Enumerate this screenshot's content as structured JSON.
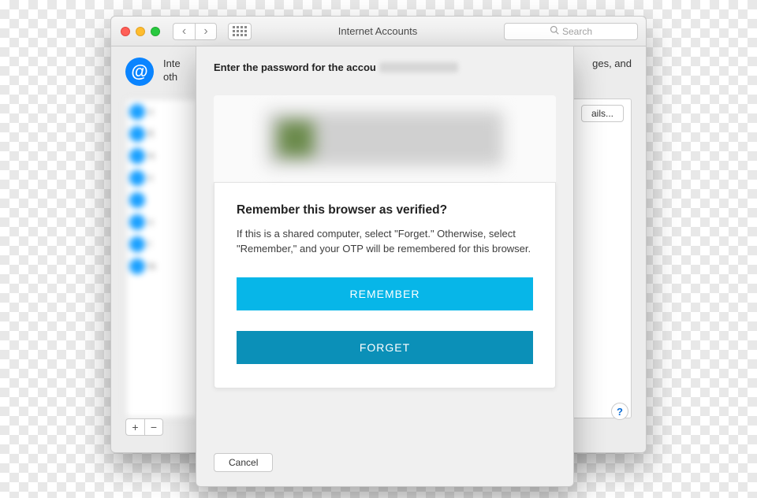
{
  "window": {
    "title": "Internet Accounts",
    "search_placeholder": "Search",
    "intro_line1": "Inte",
    "intro_line2": "oth",
    "intro_right": "ges, and",
    "details_label": "ails...",
    "add_label": "+",
    "remove_label": "−",
    "help_label": "?"
  },
  "sheet": {
    "title_prefix": "Enter the password for the accou",
    "card": {
      "heading": "Remember this browser as verified?",
      "body": "If this is a shared computer, select \"Forget.\" Otherwise, select \"Remember,\" and your OTP will be remembered for this browser.",
      "remember_label": "REMEMBER",
      "forget_label": "FORGET"
    },
    "cancel_label": "Cancel"
  },
  "sidebar": {
    "items": [
      "u",
      "E",
      "is",
      "s",
      "",
      "u",
      "t",
      "ta"
    ]
  }
}
